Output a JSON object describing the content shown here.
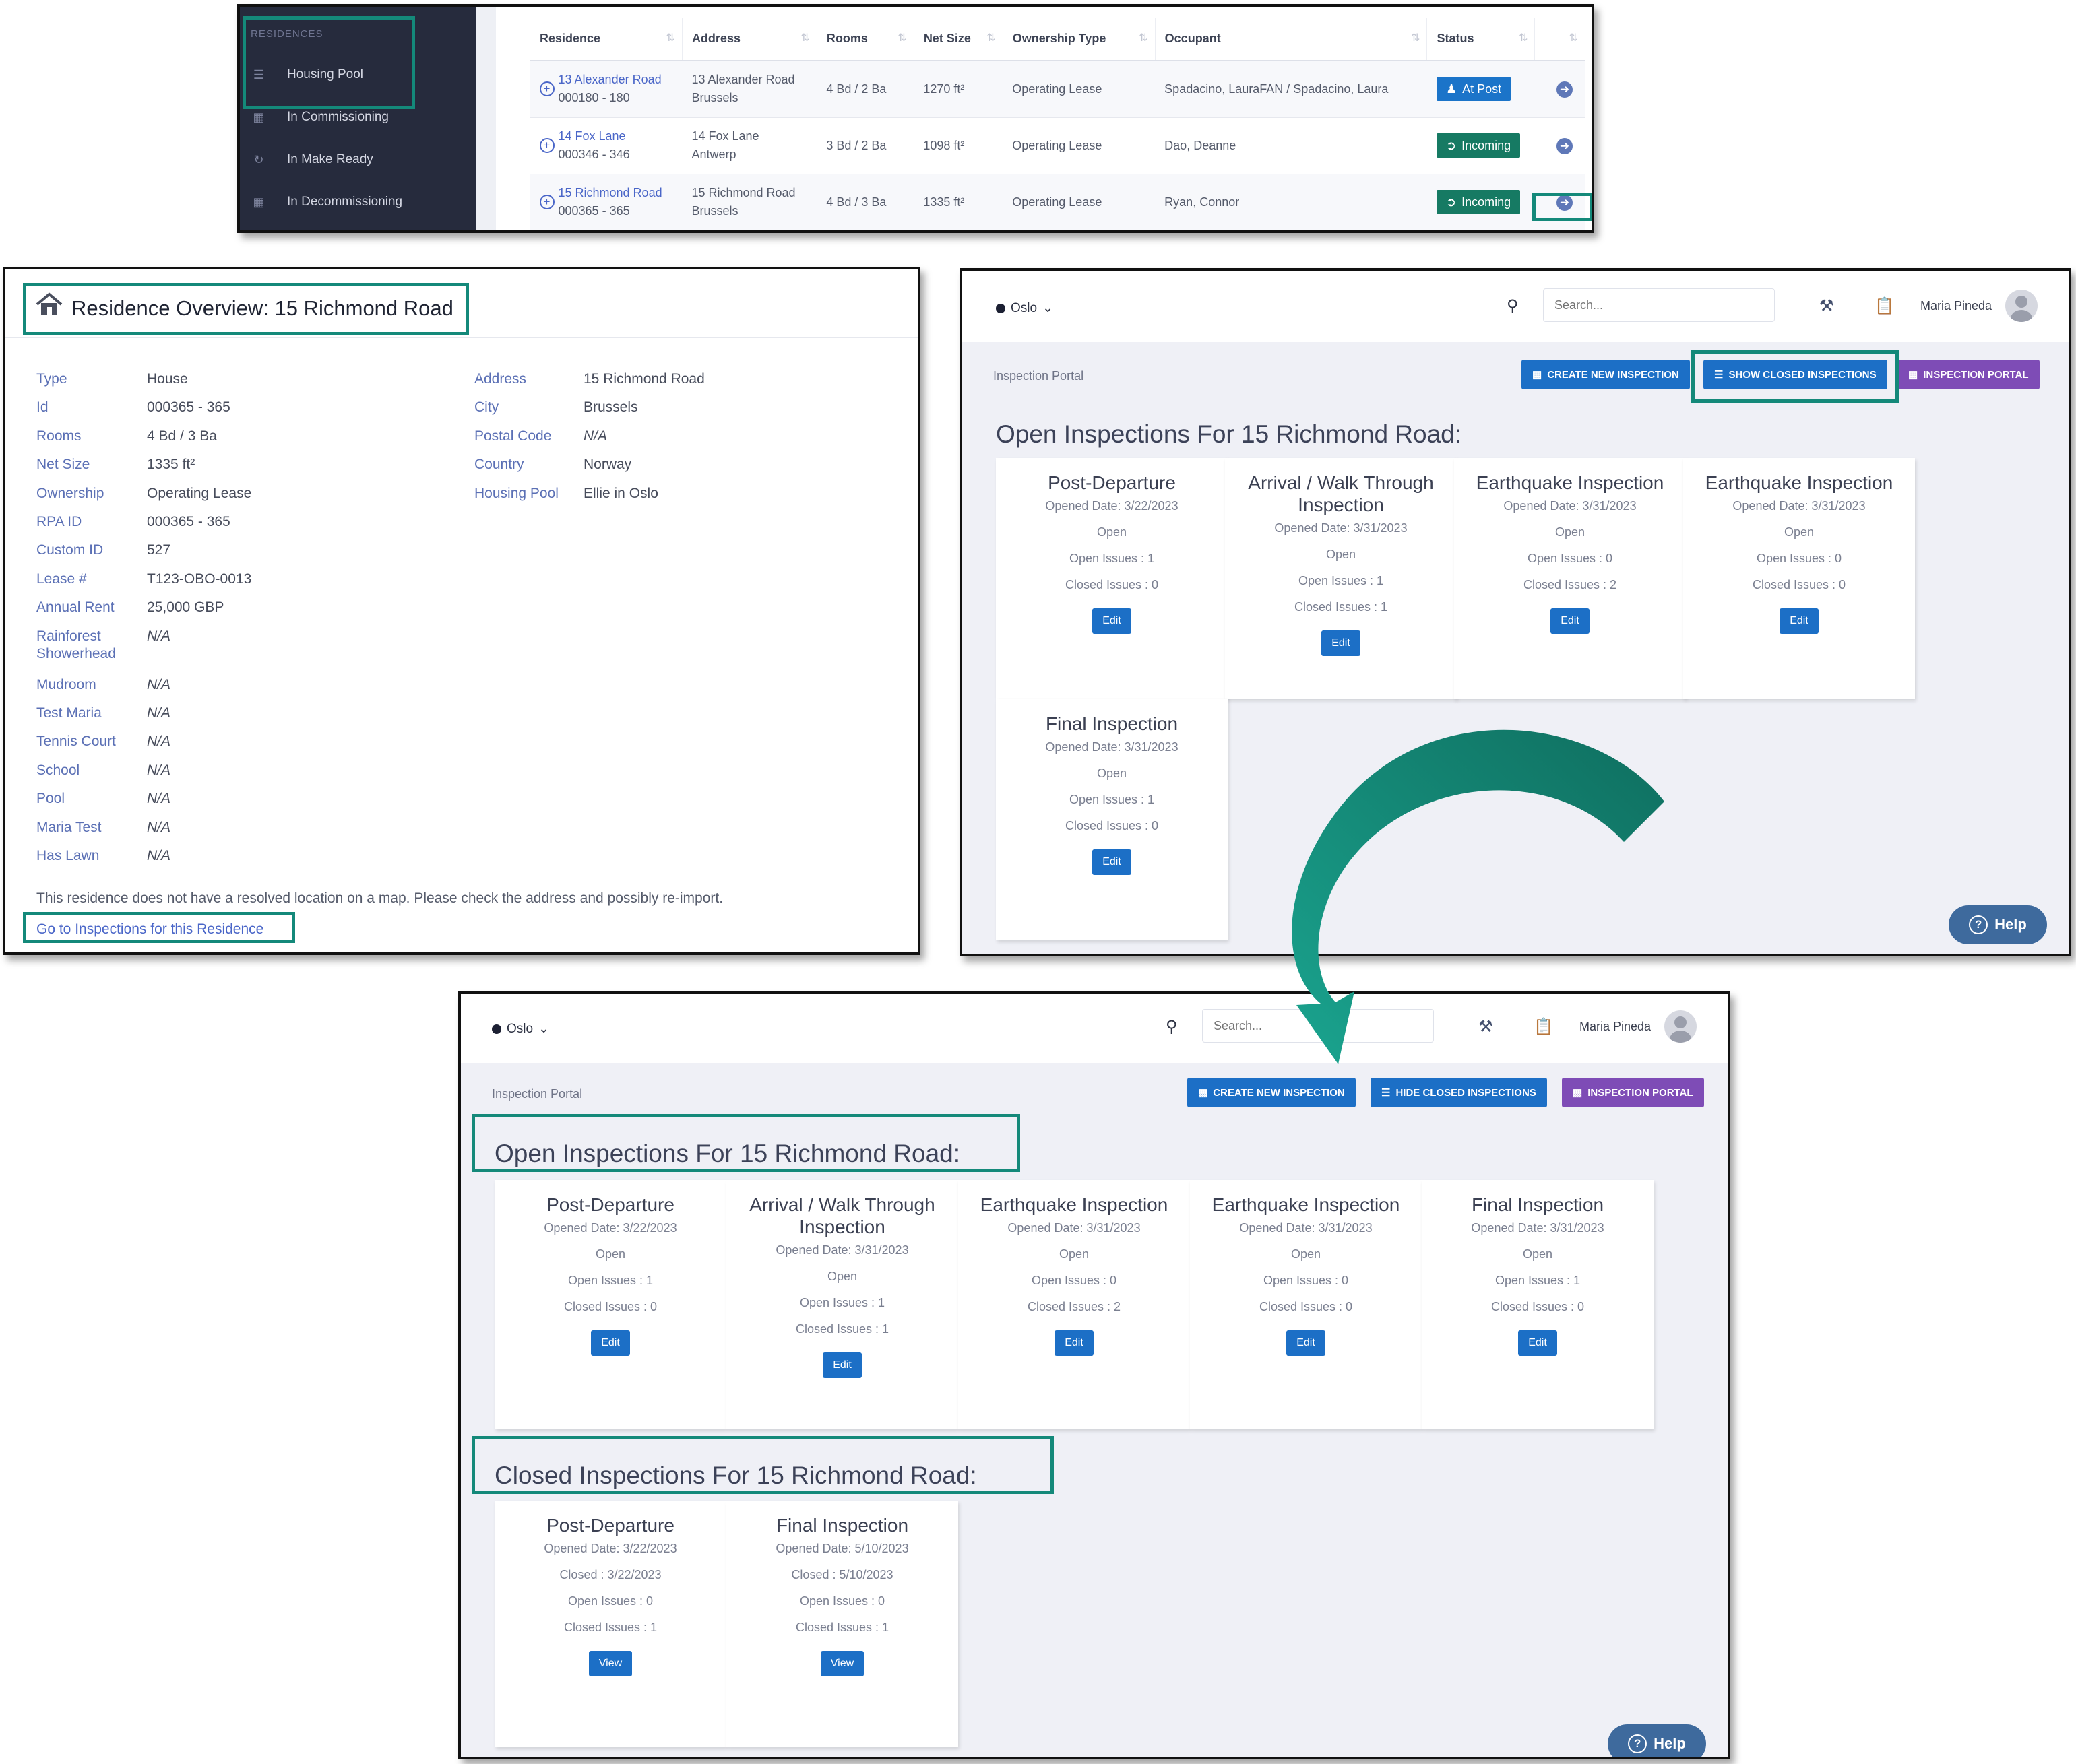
{
  "residences": {
    "sidebar": {
      "heading": "RESIDENCES",
      "items": [
        {
          "label": "Housing Pool",
          "icon": "list-icon"
        },
        {
          "label": "In Commissioning",
          "icon": "calendar-icon"
        },
        {
          "label": "In Make Ready",
          "icon": "refresh-icon"
        },
        {
          "label": "In Decommissioning",
          "icon": "calendar-icon"
        }
      ]
    },
    "columns": [
      "Residence",
      "Address",
      "Rooms",
      "Net Size",
      "Ownership Type",
      "Occupant",
      "Status"
    ],
    "rows": [
      {
        "name": "13 Alexander Road",
        "id": "000180 - 180",
        "address1": "13 Alexander Road",
        "address2": "Brussels",
        "rooms": "4 Bd / 2 Ba",
        "size": "1270 ft²",
        "ownership": "Operating Lease",
        "occupant": "Spadacino, LauraFAN / Spadacino, Laura",
        "status": "At Post",
        "status_color": "#1b74c9"
      },
      {
        "name": "14 Fox Lane",
        "id": "000346 - 346",
        "address1": "14 Fox Lane",
        "address2": "Antwerp",
        "rooms": "3 Bd / 2 Ba",
        "size": "1098 ft²",
        "ownership": "Operating Lease",
        "occupant": "Dao, Deanne",
        "status": "Incoming",
        "status_color": "#167a63"
      },
      {
        "name": "15 Richmond Road",
        "id": "000365 - 365",
        "address1": "15 Richmond Road",
        "address2": "Brussels",
        "rooms": "4 Bd / 3 Ba",
        "size": "1335 ft²",
        "ownership": "Operating Lease",
        "occupant": "Ryan, Connor",
        "status": "Incoming",
        "status_color": "#167a63"
      }
    ]
  },
  "overview": {
    "title": "Residence Overview: 15 Richmond Road",
    "left_fields": [
      {
        "label": "Type",
        "value": "House"
      },
      {
        "label": "Id",
        "value": "000365 - 365"
      },
      {
        "label": "Rooms",
        "value": "4 Bd / 3 Ba"
      },
      {
        "label": "Net Size",
        "value": "1335 ft²"
      },
      {
        "label": "Ownership",
        "value": "Operating Lease"
      },
      {
        "label": "RPA ID",
        "value": "000365 - 365"
      },
      {
        "label": "Custom ID",
        "value": "527"
      },
      {
        "label": "Lease #",
        "value": "T123-OBO-0013"
      },
      {
        "label": "Annual Rent",
        "value": "25,000 GBP"
      },
      {
        "label": "Rainforest Showerhead",
        "value": "N/A"
      },
      {
        "label": "Mudroom",
        "value": "N/A"
      },
      {
        "label": "Test Maria",
        "value": "N/A"
      },
      {
        "label": "Tennis Court",
        "value": "N/A"
      },
      {
        "label": "School",
        "value": "N/A"
      },
      {
        "label": "Pool",
        "value": "N/A"
      },
      {
        "label": "Maria Test",
        "value": "N/A"
      },
      {
        "label": "Has Lawn",
        "value": "N/A"
      }
    ],
    "right_fields": [
      {
        "label": "Address",
        "value": "15 Richmond Road"
      },
      {
        "label": "City",
        "value": "Brussels"
      },
      {
        "label": "Postal Code",
        "value": "N/A"
      },
      {
        "label": "Country",
        "value": "Norway"
      },
      {
        "label": "Housing Pool",
        "value": "Ellie in Oslo"
      }
    ],
    "note": "This residence does not have a resolved location on a map. Please check the address and possibly re-import.",
    "link": "Go to Inspections for this Residence"
  },
  "portal": {
    "location": "Oslo",
    "search_placeholder": "Search...",
    "user": "Maria Pineda",
    "breadcrumb": "Inspection Portal",
    "btn_create": "CREATE NEW INSPECTION",
    "btn_show_closed": "SHOW CLOSED INSPECTIONS",
    "btn_hide_closed": "HIDE CLOSED INSPECTIONS",
    "btn_portal": "INSPECTION PORTAL",
    "open_heading": "Open Inspections For 15 Richmond Road:",
    "closed_heading": "Closed Inspections For 15 Richmond Road:",
    "help": "Help",
    "open_cards": [
      {
        "title": "Post-Departure",
        "opened": "Opened Date: 3/22/2023",
        "state": "Open",
        "open_issues": "Open Issues : 1",
        "closed_issues": "Closed Issues : 0",
        "button": "Edit"
      },
      {
        "title": "Arrival / Walk Through Inspection",
        "opened": "Opened Date: 3/31/2023",
        "state": "Open",
        "open_issues": "Open Issues : 1",
        "closed_issues": "Closed Issues : 1",
        "button": "Edit"
      },
      {
        "title": "Earthquake Inspection",
        "opened": "Opened Date: 3/31/2023",
        "state": "Open",
        "open_issues": "Open Issues : 0",
        "closed_issues": "Closed Issues : 2",
        "button": "Edit"
      },
      {
        "title": "Earthquake Inspection",
        "opened": "Opened Date: 3/31/2023",
        "state": "Open",
        "open_issues": "Open Issues : 0",
        "closed_issues": "Closed Issues : 0",
        "button": "Edit"
      },
      {
        "title": "Final Inspection",
        "opened": "Opened Date: 3/31/2023",
        "state": "Open",
        "open_issues": "Open Issues : 1",
        "closed_issues": "Closed Issues : 0",
        "button": "Edit"
      }
    ],
    "closed_cards": [
      {
        "title": "Post-Departure",
        "opened": "Opened Date: 3/22/2023",
        "state": "Closed : 3/22/2023",
        "open_issues": "Open Issues : 0",
        "closed_issues": "Closed Issues : 1",
        "button": "View"
      },
      {
        "title": "Final Inspection",
        "opened": "Opened Date: 5/10/2023",
        "state": "Closed : 5/10/2023",
        "open_issues": "Open Issues : 0",
        "closed_issues": "Closed Issues : 1",
        "button": "View"
      }
    ]
  },
  "colors": {
    "highlight": "#14897a",
    "arrow": "#14897a",
    "primary_button": "#1c6fc6",
    "portal_button": "#7e4cb6"
  }
}
